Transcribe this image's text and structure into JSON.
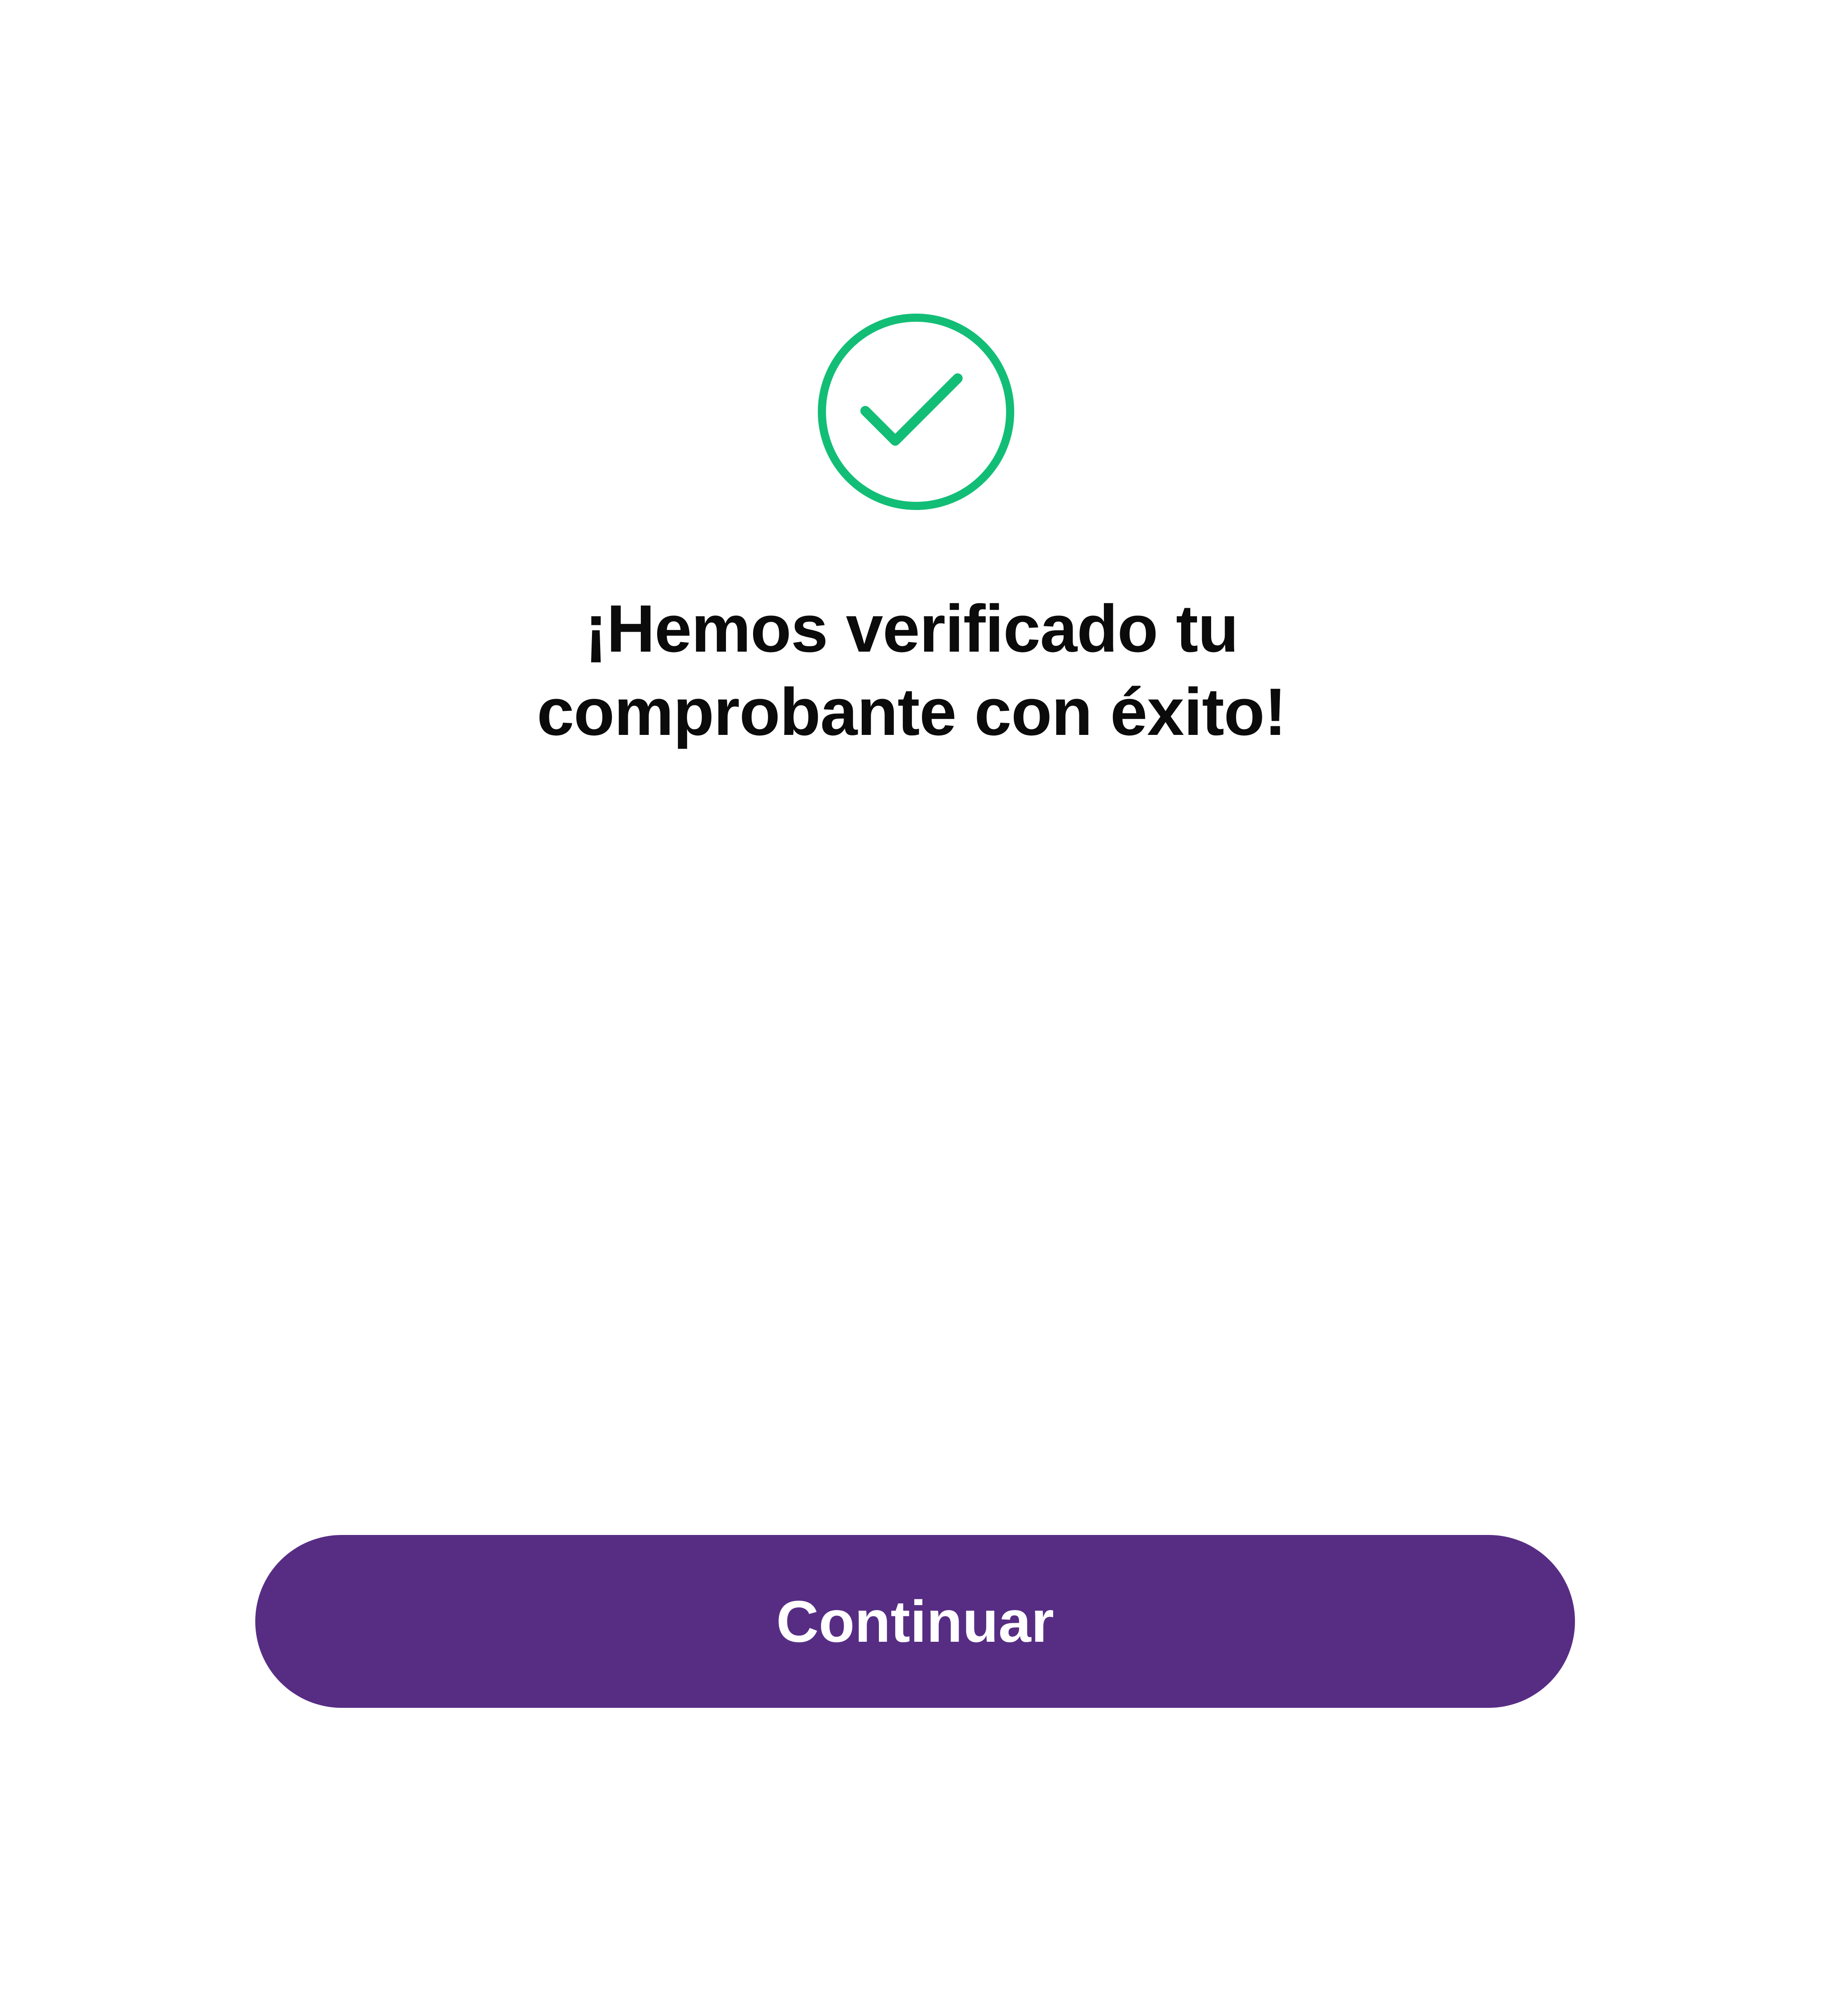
{
  "success": {
    "icon": "check-circle-icon",
    "icon_color": "#12BE76",
    "title_line1": "¡Hemos verificado tu",
    "title_line2": "comprobante con éxito!"
  },
  "actions": {
    "continue_label": "Continuar",
    "button_color": "#572D84"
  }
}
